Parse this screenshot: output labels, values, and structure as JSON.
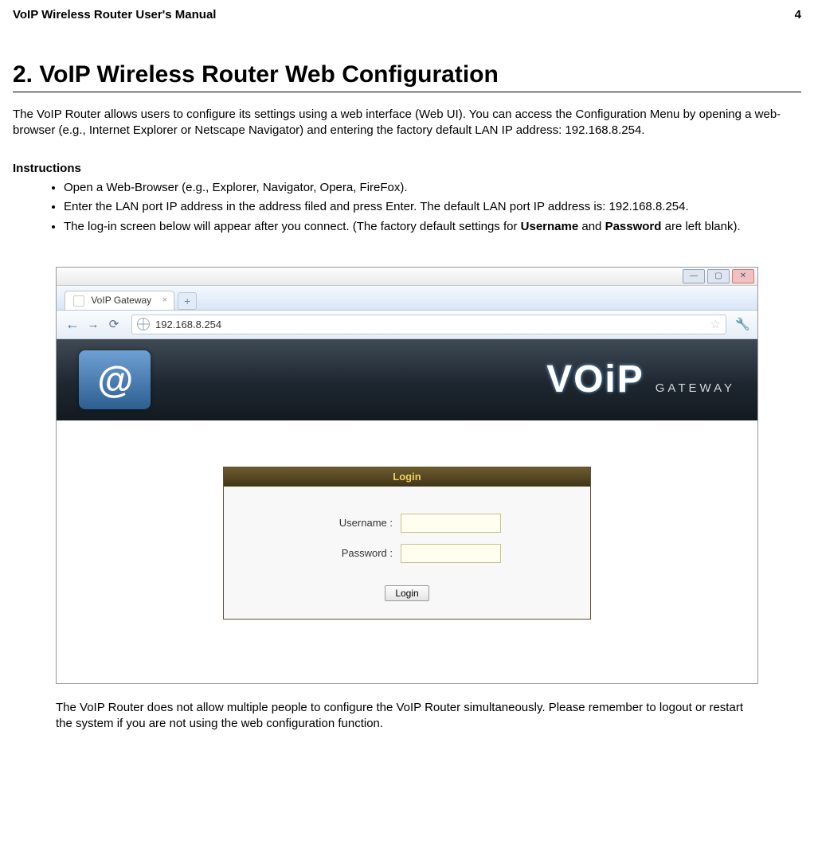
{
  "header": {
    "title": "VoIP Wireless Router User's Manual",
    "page_number": "4"
  },
  "chapter_title": "2. VoIP Wireless Router Web Configuration",
  "intro": "The VoIP Router allows users to configure its settings using a web interface (Web UI). You can access the Configuration Menu by opening a web-browser (e.g., Internet Explorer or Netscape Navigator) and entering the factory default LAN IP address: 192.168.8.254.",
  "instructions_heading": "Instructions",
  "instructions": [
    "Open a Web-Browser (e.g., Explorer, Navigator, Opera, FireFox).",
    "Enter the LAN port IP address in the address filed and press Enter. The default LAN port IP address is: 192.168.8.254."
  ],
  "instruction3": {
    "pre": "The log-in screen below will appear after you connect. (The factory default settings for ",
    "bold1": "Username",
    "mid": " and ",
    "bold2": "Password",
    "post": " are left blank)."
  },
  "browser": {
    "tab_title": "VoIP Gateway",
    "address": "192.168.8.254",
    "logo_big": "VOiP",
    "logo_small": "GATEWAY",
    "at_symbol": "@",
    "login_header": "Login",
    "username_label": "Username :",
    "password_label": "Password :",
    "login_button": "Login",
    "username_value": "",
    "password_value": ""
  },
  "footer_note": "The VoIP Router does not allow multiple people to configure the VoIP Router simultaneously. Please remember to logout or restart the system if you are not using the web configuration function."
}
